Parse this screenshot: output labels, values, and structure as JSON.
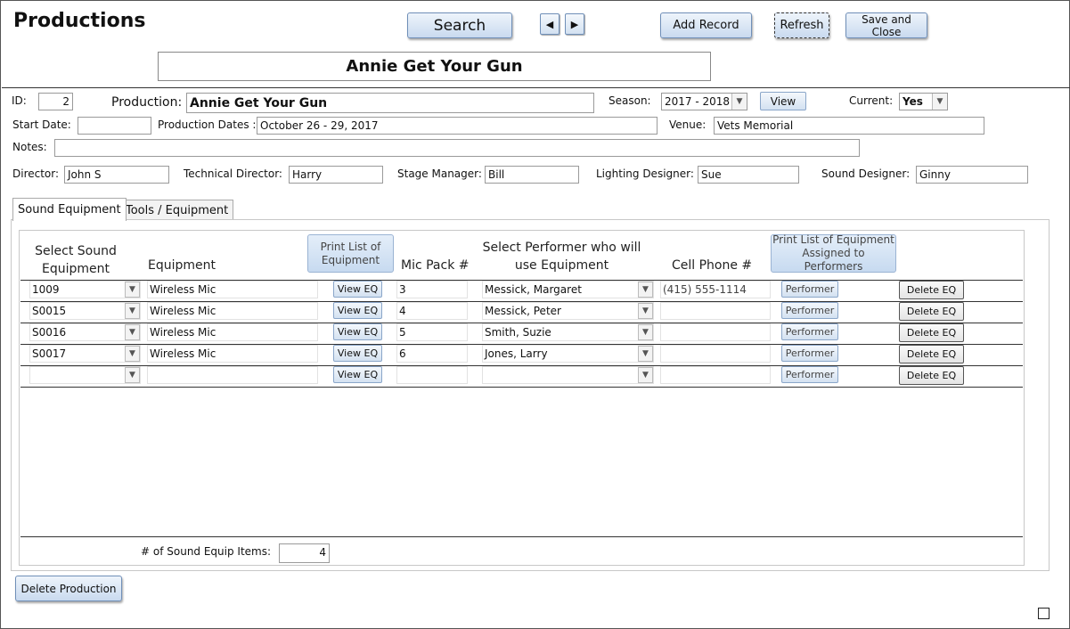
{
  "form": {
    "title": "Productions",
    "header_banner": "Annie Get Your Gun"
  },
  "toolbar": {
    "search": "Search",
    "prev_icon": "triangle-left-icon",
    "next_icon": "triangle-right-icon",
    "add_record": "Add Record",
    "refresh": "Refresh",
    "save_close": "Save and Close"
  },
  "record": {
    "id_label": "ID:",
    "id_value": "2",
    "production_label": "Production:",
    "production_value": "Annie Get Your Gun",
    "season_label": "Season:",
    "season_value": "2017 - 2018",
    "view_button": "View",
    "current_label": "Current:",
    "current_value": "Yes",
    "start_date_label": "Start Date:",
    "start_date_value": "",
    "production_dates_label": "Production Dates :",
    "production_dates_value": "October 26 - 29, 2017",
    "venue_label": "Venue:",
    "venue_value": "Vets Memorial",
    "notes_label": "Notes:",
    "notes_value": "",
    "director_label": "Director:",
    "director_value": "John S",
    "tech_director_label": "Technical Director:",
    "tech_director_value": "Harry",
    "stage_manager_label": "Stage Manager:",
    "stage_manager_value": "Bill",
    "lighting_label": "Lighting Designer:",
    "lighting_value": "Sue",
    "sound_label": "Sound Designer:",
    "sound_value": "Ginny"
  },
  "tabs": [
    {
      "label": "Sound Equipment",
      "active": true
    },
    {
      "label": "Tools / Equipment",
      "active": false
    }
  ],
  "subform": {
    "col_select_equipment": "Select Sound Equipment",
    "col_equipment": "Equipment",
    "print_list_button": "Print List of Equipment",
    "col_mic_pack": "Mic Pack #",
    "col_select_performer": "Select Performer who will use Equipment",
    "col_cell_phone": "Cell Phone #",
    "print_assigned_button": "Print List of Equipment Assigned to Performers",
    "view_eq_label": "View EQ",
    "performer_label": "Performer",
    "delete_eq_label": "Delete EQ",
    "rows": [
      {
        "equip_id": "1009",
        "equipment": "Wireless Mic",
        "mic_pack": "3",
        "performer": "Messick, Margaret",
        "cell": "(415) 555-1114"
      },
      {
        "equip_id": "S0015",
        "equipment": "Wireless Mic",
        "mic_pack": "4",
        "performer": "Messick, Peter",
        "cell": ""
      },
      {
        "equip_id": "S0016",
        "equipment": "Wireless Mic",
        "mic_pack": "5",
        "performer": "Smith, Suzie",
        "cell": ""
      },
      {
        "equip_id": "S0017",
        "equipment": "Wireless Mic",
        "mic_pack": "6",
        "performer": "Jones, Larry",
        "cell": ""
      },
      {
        "equip_id": "",
        "equipment": "",
        "mic_pack": "",
        "performer": "",
        "cell": ""
      }
    ],
    "count_label": "# of Sound Equip Items:",
    "count_value": "4"
  },
  "footer": {
    "delete_production": "Delete Production"
  },
  "colors": {
    "button_gradient_top": "#eef4fb",
    "button_gradient_bottom": "#c9daef",
    "button_border": "#6f8fb8"
  }
}
